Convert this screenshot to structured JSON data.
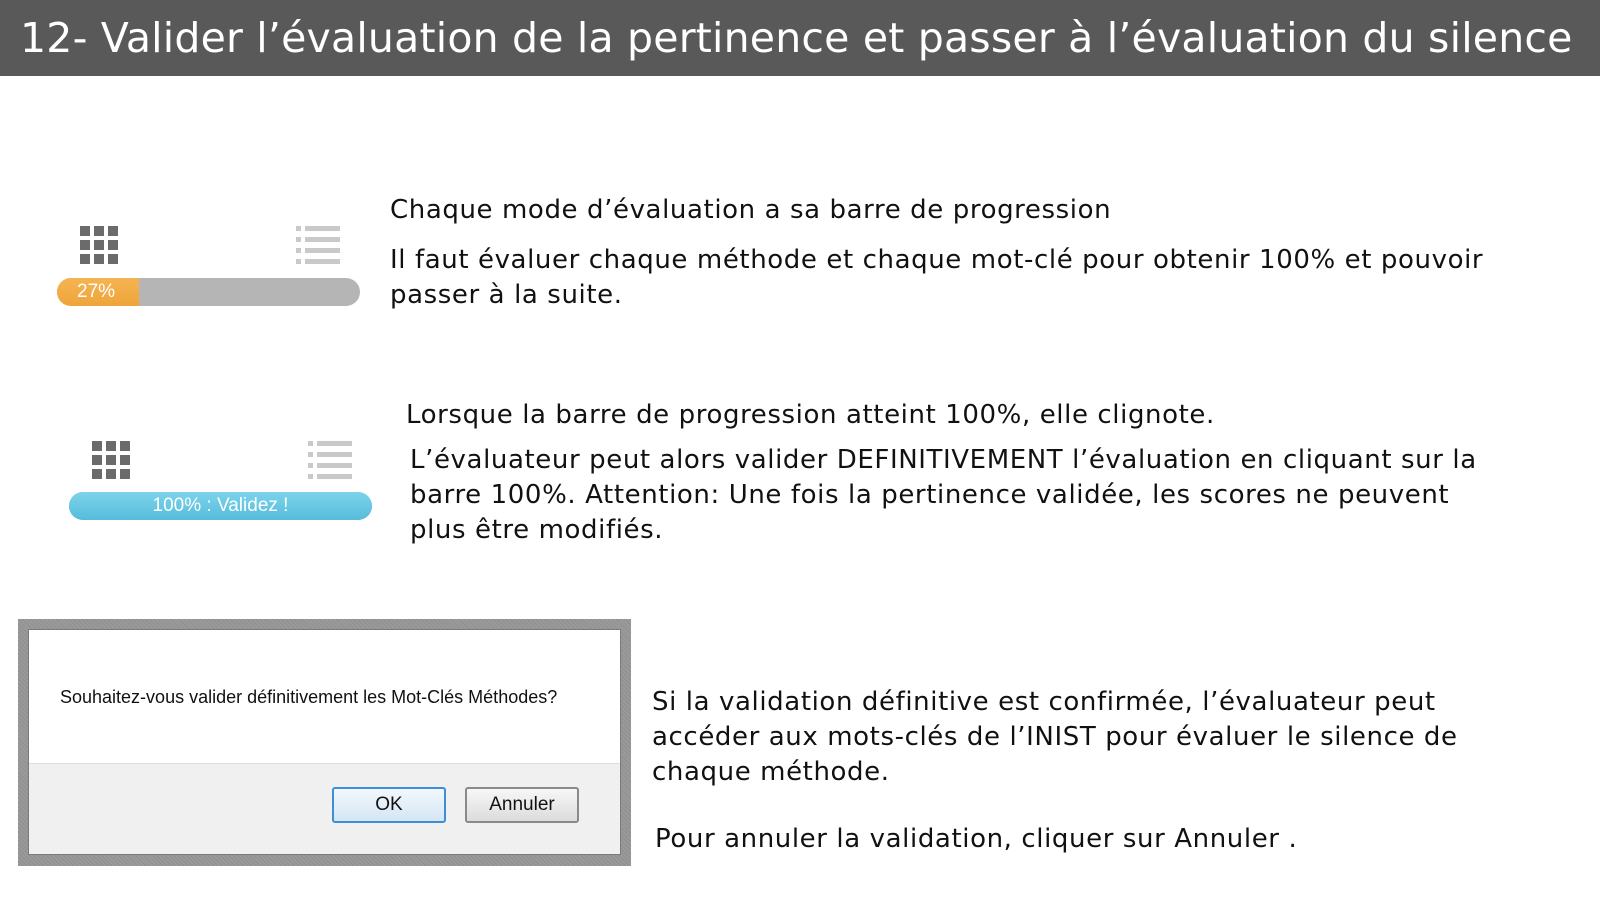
{
  "header": {
    "title": "12- Valider l’évaluation de la pertinence et passer à l’évaluation du silence"
  },
  "section1": {
    "line1": "Chaque mode d’évaluation a sa barre de progression",
    "line2": "Il faut évaluer chaque méthode et chaque mot-clé pour obtenir 100% et pouvoir",
    "line3": "passer à la suite.",
    "progress": {
      "label": "27%",
      "value": 27,
      "fill_color": "#eea53a",
      "track_color": "#b5b5b5"
    }
  },
  "section2": {
    "line1": "Lorsque la barre de progression atteint 100%, elle clignote.",
    "line2": "L’évaluateur peut alors valider DEFINITIVEMENT l’évaluation en cliquant sur la",
    "line3": "barre 100%. Attention: Une fois la pertinence validée, les scores ne peuvent",
    "line4": "plus être modifiés.",
    "progress": {
      "label": "100% : Validez !",
      "value": 100,
      "fill_color": "#5cc3e0"
    }
  },
  "dialog": {
    "message": "Souhaitez-vous valider définitivement les Mot-Clés Méthodes?",
    "ok_label": "OK",
    "cancel_label": "Annuler"
  },
  "section3": {
    "line1": "Si la validation définitive est confirmée, l’évaluateur peut",
    "line2": "accéder aux mots-clés de l’INIST pour évaluer le silence de",
    "line3": "chaque méthode.",
    "line4": "Pour annuler la validation, cliquer  sur Annuler ."
  },
  "icons": {
    "grid": "grid-view-icon",
    "list": "list-view-icon"
  }
}
